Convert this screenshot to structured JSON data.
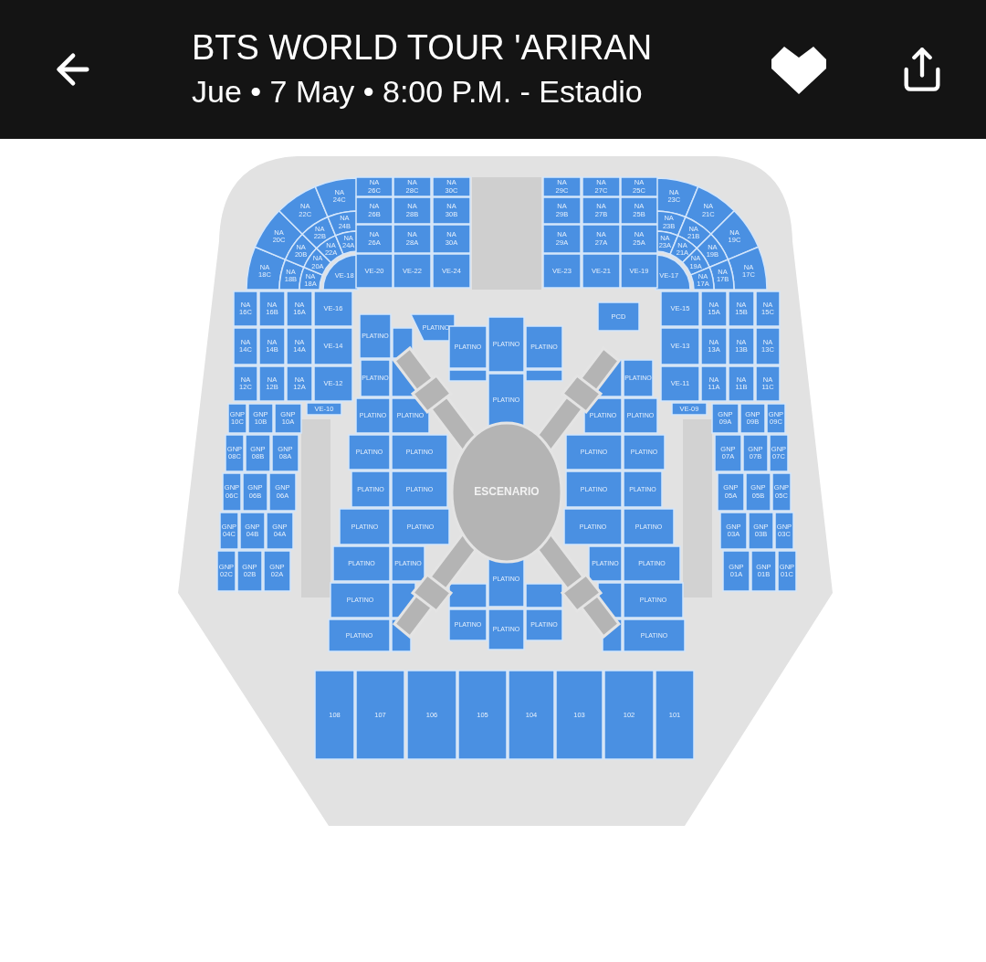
{
  "header": {
    "title": "BTS WORLD TOUR 'ARIRAN",
    "subtitle": "Jue • 7 May • 8:00 P.M. - Estadio",
    "favorited": true
  },
  "map": {
    "stage_label": "ESCENARIO",
    "zones": [
      {
        "kind": "stand-left",
        "sections": [
          "NA 18C",
          "NA 20C",
          "NA 22C",
          "NA 24C",
          "NA 18B",
          "NA 20B",
          "NA 22B",
          "NA 24B",
          "NA 18A",
          "NA 20A",
          "NA 22A",
          "NA 24A",
          "VE-18",
          "NA 26C",
          "NA 28C",
          "NA 30C",
          "NA 26B",
          "NA 28B",
          "NA 30B",
          "NA 26A",
          "NA 28A",
          "NA 30A",
          "VE-20",
          "VE-22",
          "VE-24",
          "NA 16C",
          "NA 16B",
          "NA 16A",
          "VE-16",
          "NA 14C",
          "NA 14B",
          "NA 14A",
          "VE-14",
          "NA 12C",
          "NA 12B",
          "NA 12A",
          "VE-12",
          "VE-10",
          "GNP 10C",
          "GNP 10B",
          "GNP 10A",
          "GNP 08C",
          "GNP 08B",
          "GNP 08A",
          "GNP 06C",
          "GNP 06B",
          "GNP 06A",
          "GNP 04C",
          "GNP 04B",
          "GNP 04A",
          "GNP 02C",
          "GNP 02B",
          "GNP 02A"
        ]
      },
      {
        "kind": "stand-right",
        "sections": [
          "NA 23C",
          "NA 21C",
          "NA 19C",
          "NA 17C",
          "NA 23B",
          "NA 21B",
          "NA 19B",
          "NA 17B",
          "NA 23A",
          "NA 21A",
          "NA 19A",
          "NA 17A",
          "VE-17",
          "NA 29C",
          "NA 27C",
          "NA 25C",
          "NA 29B",
          "NA 27B",
          "NA 25B",
          "NA 29A",
          "NA 27A",
          "NA 25A",
          "VE-23",
          "VE-21",
          "VE-19",
          "VE-15",
          "NA 15A",
          "NA 15B",
          "NA 15C",
          "VE-13",
          "NA 13A",
          "NA 13B",
          "NA 13C",
          "VE-11",
          "NA 11A",
          "NA 11B",
          "NA 11C",
          "VE-09",
          "GNP 09A",
          "GNP 09B",
          "GNP 09C",
          "GNP 07A",
          "GNP 07B",
          "GNP 07C",
          "GNP 05A",
          "GNP 05B",
          "GNP 05C",
          "GNP 03A",
          "GNP 03B",
          "GNP 03C",
          "GNP 01A",
          "GNP 01B",
          "GNP 01C"
        ]
      },
      {
        "kind": "floor-left",
        "sections": [
          "PLATINO",
          "PLATINO",
          "PLATINO",
          "PLATINO",
          "PLATINO",
          "PLATINO",
          "PLATINO",
          "PLATINO",
          "PLATINO",
          "PLATINO",
          "PLATINO",
          "PLATINO",
          "PLATINO"
        ]
      },
      {
        "kind": "floor-right",
        "sections": [
          "PLATINO",
          "PLATINO",
          "PLATINO",
          "PLATINO",
          "PLATINO",
          "PLATINO",
          "PLATINO",
          "PLATINO",
          "PLATINO",
          "PLATINO",
          "PLATINO",
          "PLATINO",
          "PLATINO"
        ]
      },
      {
        "kind": "center",
        "sections": [
          "PLATINO",
          "PLATINO",
          "PLATINO",
          "PLATINO",
          "PLATINO",
          "PLATINO",
          "PLATINO",
          "PLATINO",
          "PLATINO",
          "PLATINO",
          "PCD"
        ]
      },
      {
        "kind": "lower",
        "sections": [
          "108",
          "107",
          "106",
          "105",
          "104",
          "103",
          "102",
          "101"
        ]
      }
    ]
  }
}
